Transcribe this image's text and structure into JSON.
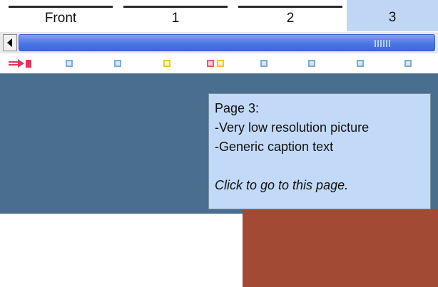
{
  "tabs": [
    {
      "label": "Front",
      "active": false
    },
    {
      "label": "1",
      "active": false
    },
    {
      "label": "2",
      "active": false
    },
    {
      "label": "3",
      "active": true
    }
  ],
  "scrollbar": {
    "left_arrow_icon": "triangle-left-icon",
    "grip_icon": "grip-lines-icon"
  },
  "page_strip": {
    "current_indicator_icon": "red-arrow-icon",
    "markers": [
      "plain",
      "plain",
      "yellow",
      "pink",
      "yellow",
      "plain",
      "plain",
      "plain",
      "plain"
    ]
  },
  "tooltip": {
    "title": "Page 3:",
    "lines": [
      "-Very low resolution picture",
      "-Generic caption text"
    ],
    "hint": "Click to go to this page."
  },
  "colors": {
    "active_tab": "#bfd7f5",
    "scroll_thumb": "#4b76e4",
    "canvas": "#4a6e8d",
    "tooltip_bg": "#c2d9f7",
    "current_marker": "#e23361"
  }
}
